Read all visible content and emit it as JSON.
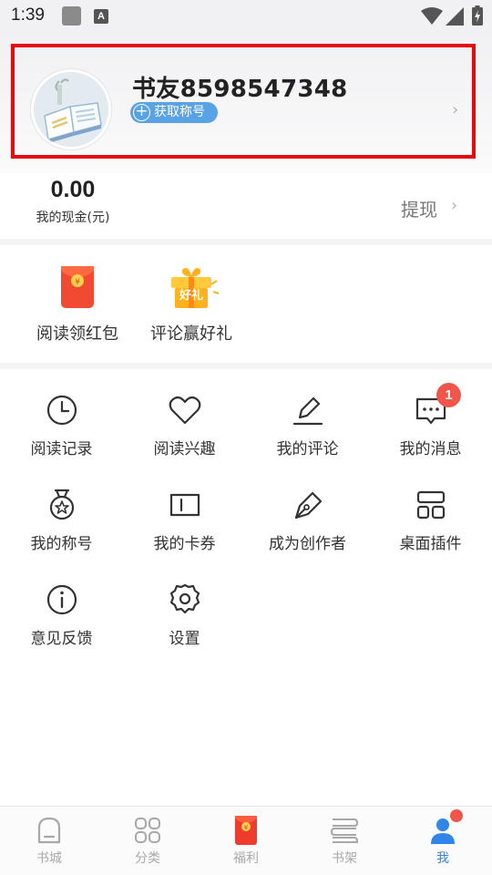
{
  "status_bar": {
    "time": "1:39",
    "a_icon": "A"
  },
  "profile": {
    "username": "书友8598547348",
    "title_button": "获取称号"
  },
  "wallet": {
    "amount": "0.00",
    "amount_label": "我的现金(元)",
    "withdraw_label": "提现"
  },
  "promos": [
    {
      "label": "阅读领红包",
      "icon": "red-envelope-icon"
    },
    {
      "label": "评论赢好礼",
      "icon": "gift-box-icon",
      "icon_text": "好礼"
    }
  ],
  "menu": [
    {
      "label": "阅读记录",
      "icon": "clock-icon"
    },
    {
      "label": "阅读兴趣",
      "icon": "heart-icon"
    },
    {
      "label": "我的评论",
      "icon": "pencil-icon"
    },
    {
      "label": "我的消息",
      "icon": "message-icon",
      "badge": "1"
    },
    {
      "label": "我的称号",
      "icon": "medal-icon"
    },
    {
      "label": "我的卡券",
      "icon": "coupon-icon"
    },
    {
      "label": "成为创作者",
      "icon": "pen-nib-icon"
    },
    {
      "label": "桌面插件",
      "icon": "widget-icon"
    },
    {
      "label": "意见反馈",
      "icon": "info-icon"
    },
    {
      "label": "设置",
      "icon": "gear-icon"
    }
  ],
  "bottom_nav": [
    {
      "label": "书城",
      "icon": "bookstore-icon",
      "active": false
    },
    {
      "label": "分类",
      "icon": "category-icon",
      "active": false
    },
    {
      "label": "福利",
      "icon": "red-envelope-icon",
      "active": false
    },
    {
      "label": "书架",
      "icon": "bookshelf-icon",
      "active": false
    },
    {
      "label": "我",
      "icon": "user-icon",
      "active": true
    }
  ],
  "colors": {
    "accent": "#2f86e8",
    "pill": "#5aa2e6",
    "badge": "#f0574a",
    "highlight_border": "#e8090f"
  }
}
